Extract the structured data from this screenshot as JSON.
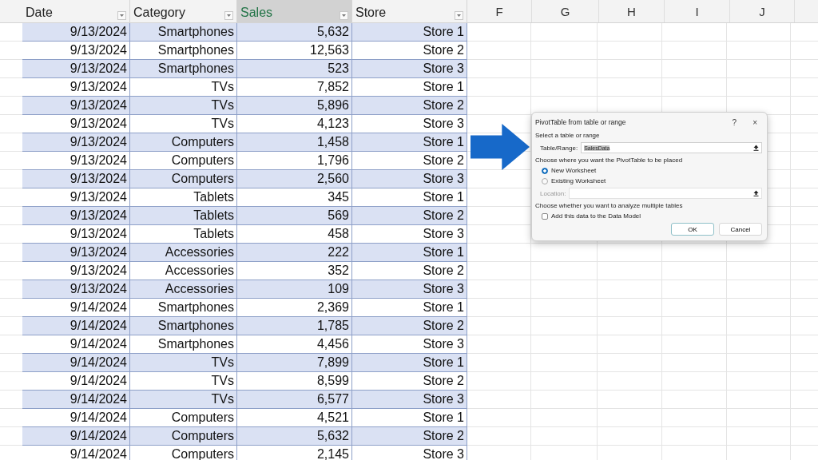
{
  "table": {
    "columns": [
      {
        "label": "Date",
        "selected": false
      },
      {
        "label": "Category",
        "selected": false
      },
      {
        "label": "Sales",
        "selected": true
      },
      {
        "label": "Store",
        "selected": false
      }
    ],
    "sheet_columns": [
      "F",
      "G",
      "H",
      "I",
      "J"
    ],
    "rows": [
      [
        "9/13/2024",
        "Smartphones",
        "5,632",
        "Store 1"
      ],
      [
        "9/13/2024",
        "Smartphones",
        "12,563",
        "Store 2"
      ],
      [
        "9/13/2024",
        "Smartphones",
        "523",
        "Store 3"
      ],
      [
        "9/13/2024",
        "TVs",
        "7,852",
        "Store 1"
      ],
      [
        "9/13/2024",
        "TVs",
        "5,896",
        "Store 2"
      ],
      [
        "9/13/2024",
        "TVs",
        "4,123",
        "Store 3"
      ],
      [
        "9/13/2024",
        "Computers",
        "1,458",
        "Store 1"
      ],
      [
        "9/13/2024",
        "Computers",
        "1,796",
        "Store 2"
      ],
      [
        "9/13/2024",
        "Computers",
        "2,560",
        "Store 3"
      ],
      [
        "9/13/2024",
        "Tablets",
        "345",
        "Store 1"
      ],
      [
        "9/13/2024",
        "Tablets",
        "569",
        "Store 2"
      ],
      [
        "9/13/2024",
        "Tablets",
        "458",
        "Store 3"
      ],
      [
        "9/13/2024",
        "Accessories",
        "222",
        "Store 1"
      ],
      [
        "9/13/2024",
        "Accessories",
        "352",
        "Store 2"
      ],
      [
        "9/13/2024",
        "Accessories",
        "109",
        "Store 3"
      ],
      [
        "9/14/2024",
        "Smartphones",
        "2,369",
        "Store 1"
      ],
      [
        "9/14/2024",
        "Smartphones",
        "1,785",
        "Store 2"
      ],
      [
        "9/14/2024",
        "Smartphones",
        "4,456",
        "Store 3"
      ],
      [
        "9/14/2024",
        "TVs",
        "7,899",
        "Store 1"
      ],
      [
        "9/14/2024",
        "TVs",
        "8,599",
        "Store 2"
      ],
      [
        "9/14/2024",
        "TVs",
        "6,577",
        "Store 3"
      ],
      [
        "9/14/2024",
        "Computers",
        "4,521",
        "Store 1"
      ],
      [
        "9/14/2024",
        "Computers",
        "5,632",
        "Store 2"
      ],
      [
        "9/14/2024",
        "Computers",
        "2,145",
        "Store 3"
      ]
    ]
  },
  "dialog": {
    "title": "PivotTable from table or range",
    "help": "?",
    "close": "×",
    "section_1": "Select a table or range",
    "range_label": "Table/Range:",
    "range_value": "SalesData",
    "section_2": "Choose where you want the PivotTable to be placed",
    "options": [
      {
        "label": "New Worksheet",
        "selected": true
      },
      {
        "label": "Existing Worksheet",
        "selected": false
      }
    ],
    "location_label": "Location:",
    "section_3": "Choose whether you want to analyze multiple tables",
    "data_model": {
      "label": "Add this data to the Data Model",
      "checked": false
    },
    "buttons": [
      "OK",
      "Cancel"
    ]
  }
}
